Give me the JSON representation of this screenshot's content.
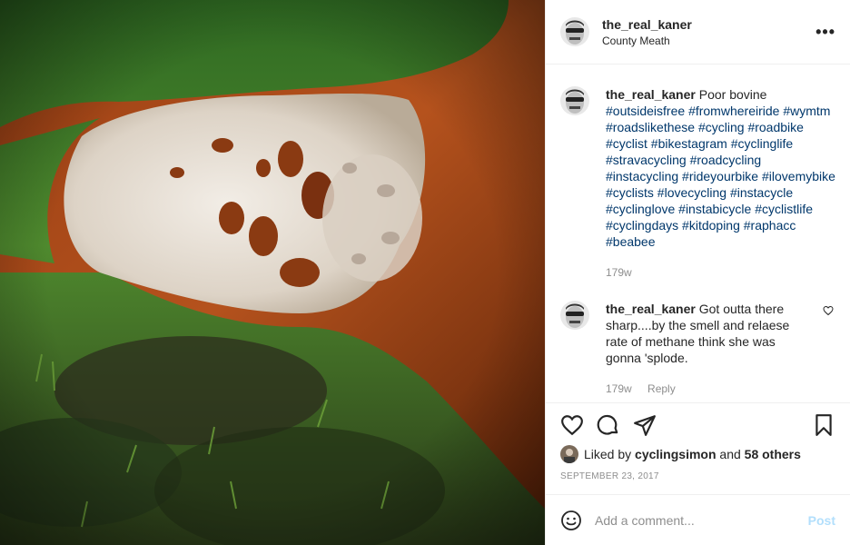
{
  "post": {
    "username": "the_real_kaner",
    "location": "County Meath",
    "more_icon": "ellipsis-icon",
    "caption": {
      "username": "the_real_kaner",
      "text": "Poor bovine",
      "hashtags": [
        "#outsideisfree",
        "#fromwhereiride",
        "#wymtm",
        "#roadslikethese",
        "#cycling",
        "#roadbike",
        "#cyclist",
        "#bikestagram",
        "#cyclinglife",
        "#stravacycling",
        "#roadcycling",
        "#instacycling",
        "#rideyourbike",
        "#ilovemybike",
        "#cyclists",
        "#lovecycling",
        "#instacycle",
        "#cyclinglove",
        "#instabicycle",
        "#cyclistlife",
        "#cyclingdays",
        "#kitdoping",
        "#raphacc",
        "#beabee"
      ],
      "age": "179w"
    },
    "comment": {
      "username": "the_real_kaner",
      "text": "Got outta there sharp....by the smell and relaese rate of methane think she was gonna 'splode.",
      "age": "179w",
      "reply_label": "Reply"
    },
    "likes": {
      "prefix": "Liked by",
      "user": "cyclingsimon",
      "and": "and",
      "others": "58 others"
    },
    "date": "SEPTEMBER 23, 2017",
    "add_comment_placeholder": "Add a comment...",
    "post_button": "Post",
    "colors": {
      "link": "#00376b",
      "muted": "#8e8e8e",
      "post_button": "#b2dffc"
    }
  }
}
